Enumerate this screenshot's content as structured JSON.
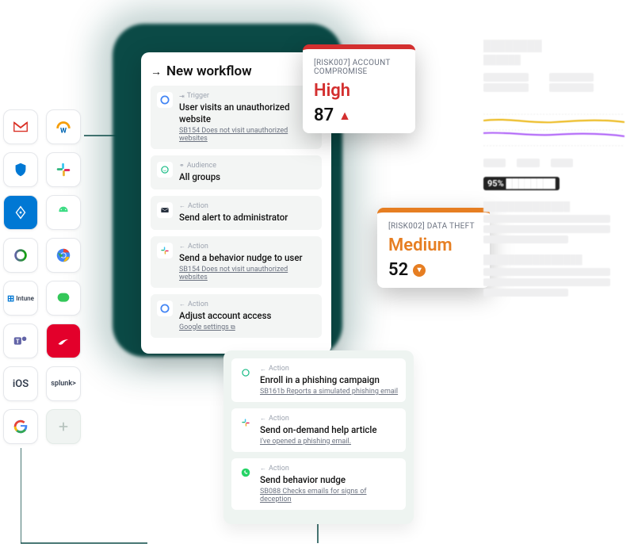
{
  "integrations": [
    {
      "name": "gmail"
    },
    {
      "name": "workday"
    },
    {
      "name": "defender"
    },
    {
      "name": "slack"
    },
    {
      "name": "azure-ad"
    },
    {
      "name": "android"
    },
    {
      "name": "copilot"
    },
    {
      "name": "chrome"
    },
    {
      "name": "intune",
      "label": "Intune"
    },
    {
      "name": "messages"
    },
    {
      "name": "teams"
    },
    {
      "name": "crowdstrike"
    },
    {
      "name": "ios",
      "label": "iOS"
    },
    {
      "name": "splunk",
      "label": "splunk>"
    },
    {
      "name": "google"
    },
    {
      "name": "add"
    }
  ],
  "workflow": {
    "title": "New workflow",
    "steps": [
      {
        "icon": "google",
        "type": "Trigger",
        "label": "User visits an unauthorized website",
        "sub": "SB154 Does not visit unauthorized websites",
        "sub_type": "link"
      },
      {
        "icon": "culture",
        "type": "Audience",
        "label": "All groups"
      },
      {
        "icon": "mail",
        "type": "Action",
        "label": "Send alert to administrator"
      },
      {
        "icon": "slack",
        "type": "Action",
        "label": "Send a behavior nudge to user",
        "sub": "SB154 Does not visit unauthorized websites",
        "sub_type": "link"
      },
      {
        "icon": "google",
        "type": "Action",
        "label": "Adjust account access",
        "sub": "Google settings",
        "sub_type": "external"
      }
    ]
  },
  "workflow2": {
    "steps": [
      {
        "icon": "culture",
        "type": "Action",
        "label": "Enroll in a phishing campaign",
        "sub": "SB161b Reports a simulated phishing email",
        "sub_type": "link"
      },
      {
        "icon": "slack",
        "type": "Action",
        "label": "Send on-demand help article",
        "sub": "I've opened a phishing email.",
        "sub_type": "link"
      },
      {
        "icon": "whatsapp",
        "type": "Action",
        "label": "Send behavior nudge",
        "sub": "SB088 Checks emails for signs of deception",
        "sub_type": "link"
      }
    ]
  },
  "risks": {
    "high": {
      "code": "[RISK007] ACCOUNT COMPROMISE",
      "level": "High",
      "score": "87"
    },
    "med": {
      "code": "[RISK002] DATA THEFT",
      "level": "Medium",
      "score": "52"
    }
  },
  "dashboard": {
    "pill": "95%"
  }
}
